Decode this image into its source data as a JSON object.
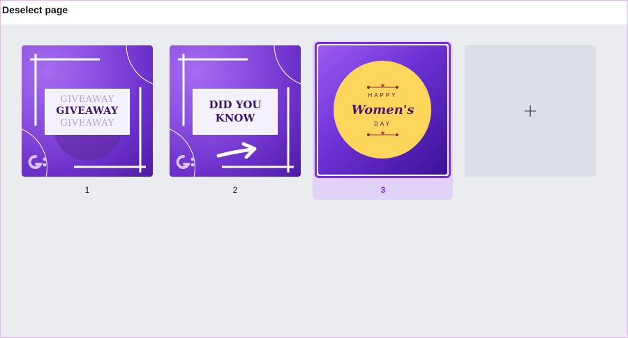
{
  "topbar": {
    "deselect_label": "Deselect page"
  },
  "pages": [
    {
      "number": "1",
      "lines": [
        "GIVEAWAY",
        "GIVEAWAY",
        "GIVEAWAY"
      ],
      "logo_icon": "gt-logo-icon"
    },
    {
      "number": "2",
      "lines": [
        "DID YOU",
        "KNOW"
      ],
      "arrow_icon": "arrow-right-icon",
      "logo_icon": "gt-logo-icon"
    },
    {
      "number": "3",
      "selected": true,
      "lines": [
        "HAPPY",
        "Women's",
        "DAY"
      ]
    }
  ],
  "add_page": {
    "icon": "plus-icon",
    "symbol": "+"
  },
  "colors": {
    "accent": "#7d2ae8",
    "selected_bg": "#e0d3f7",
    "canvas_bg": "#ebecf0",
    "yellow": "#ffd65c"
  }
}
